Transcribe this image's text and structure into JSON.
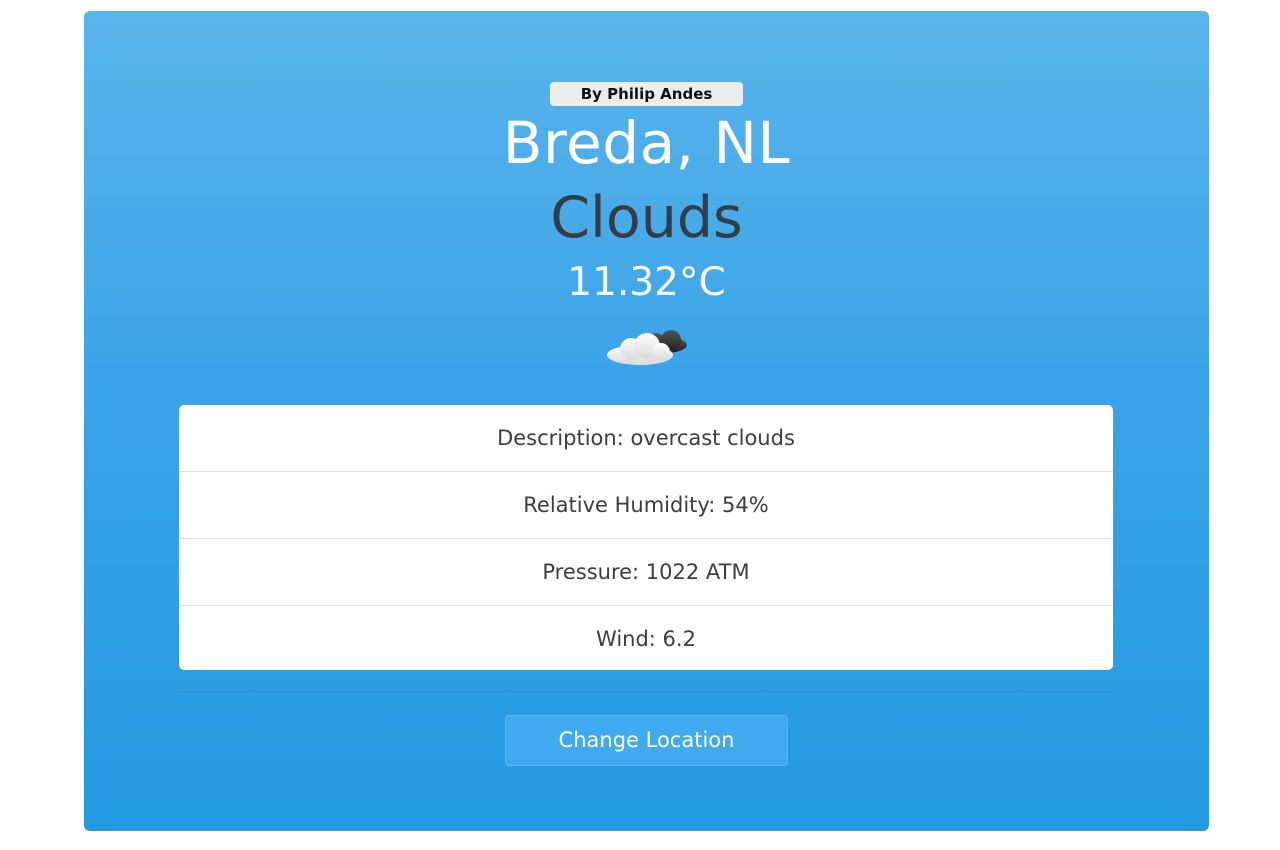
{
  "header": {
    "author_badge": "By Philip Andes",
    "location": "Breda, NL",
    "condition": "Clouds",
    "temperature": "11.32°C",
    "weather_icon": "cloud-icon"
  },
  "details": [
    {
      "text": "Description: overcast clouds"
    },
    {
      "text": "Relative Humidity: 54%"
    },
    {
      "text": "Pressure: 1022 ATM"
    },
    {
      "text": "Wind: 6.2"
    }
  ],
  "actions": {
    "change_location_label": "Change Location"
  },
  "colors": {
    "card_top": "#59b4ea",
    "card_bottom": "#2399e2",
    "condition_text": "#333d47"
  }
}
